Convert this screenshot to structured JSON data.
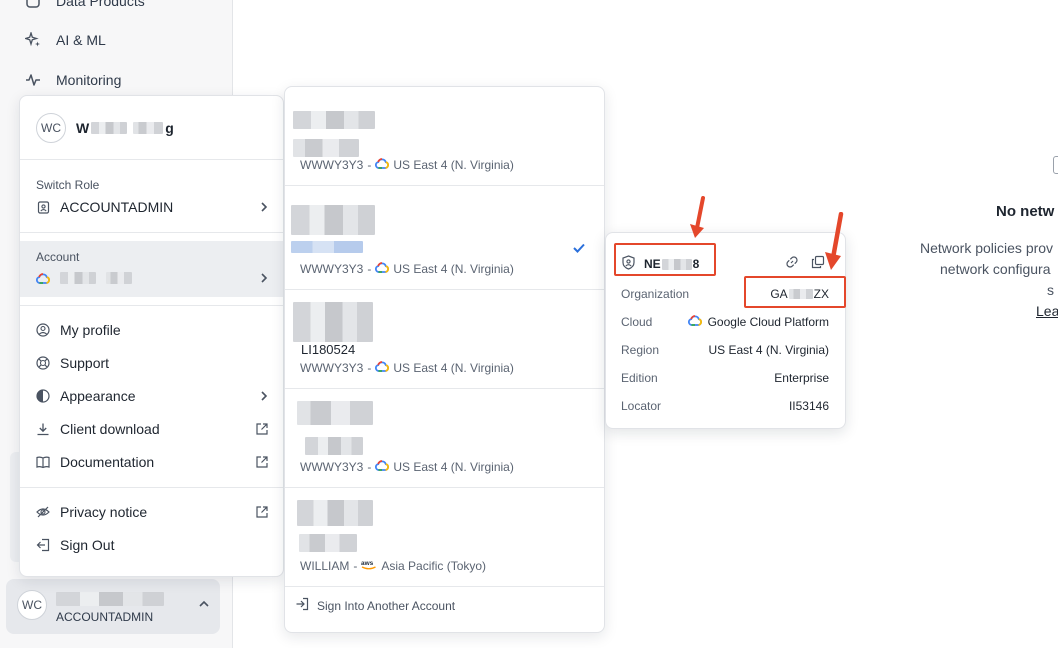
{
  "sidebar": {
    "items": [
      {
        "label": "Data Products",
        "icon": "data-products-icon"
      },
      {
        "label": "AI & ML",
        "icon": "sparkle-icon"
      },
      {
        "label": "Monitoring",
        "icon": "activity-icon"
      }
    ],
    "user_chip": {
      "initials": "WC",
      "role": "ACCOUNTADMIN"
    }
  },
  "user_menu": {
    "avatar_initials": "WC",
    "user_name_visible": "W",
    "user_name_tail": "g",
    "switch_role": {
      "label": "Switch Role",
      "value": "ACCOUNTADMIN"
    },
    "account": {
      "label": "Account"
    },
    "items": [
      {
        "label": "My profile",
        "icon": "user-circle-icon"
      },
      {
        "label": "Support",
        "icon": "lifebuoy-icon"
      },
      {
        "label": "Appearance",
        "icon": "contrast-icon"
      },
      {
        "label": "Client download",
        "icon": "download-icon"
      },
      {
        "label": "Documentation",
        "icon": "book-icon"
      }
    ],
    "footer_items": [
      {
        "label": "Privacy notice",
        "icon": "eye-off-icon"
      },
      {
        "label": "Sign Out",
        "icon": "sign-out-icon"
      }
    ]
  },
  "accounts": {
    "list": [
      {
        "org": "WWWY3Y3",
        "separator": "-",
        "region": "US East 4 (N. Virginia)",
        "cloud": "gcp",
        "selected": false,
        "fragment": ""
      },
      {
        "org": "WWWY3Y3",
        "separator": "-",
        "region": "US East 4 (N. Virginia)",
        "cloud": "gcp",
        "selected": true,
        "fragment": ""
      },
      {
        "org": "WWWY3Y3",
        "separator": "-",
        "region": "US East 4 (N. Virginia)",
        "cloud": "gcp",
        "selected": false,
        "fragment": "LI180524"
      },
      {
        "org": "WWWY3Y3",
        "separator": "-",
        "region": "US East 4 (N. Virginia)",
        "cloud": "gcp",
        "selected": false,
        "fragment": ""
      },
      {
        "org": "WILLIAM",
        "separator": "-",
        "region": "Asia Pacific (Tokyo)",
        "cloud": "aws",
        "selected": false,
        "fragment": ""
      }
    ],
    "sign_in_other": "Sign Into Another Account"
  },
  "account_details": {
    "name_prefix": "NE",
    "name_suffix": "8",
    "rows": [
      {
        "key": "Organization",
        "value_prefix": "GA",
        "value_suffix": "ZX"
      },
      {
        "key": "Cloud",
        "value": "Google Cloud Platform"
      },
      {
        "key": "Region",
        "value": "US East 4 (N. Virginia)"
      },
      {
        "key": "Edition",
        "value": "Enterprise"
      },
      {
        "key": "Locator",
        "value": "II53146"
      }
    ]
  },
  "main": {
    "empty_title": "No netw",
    "line1": "Network policies prov",
    "line2": "network configura",
    "line3": "s",
    "learn_more": "Lea"
  },
  "colors": {
    "accent": "#2a6fdb",
    "annotation_red": "#e4472b",
    "sidebar_bg": "#f7f7f8"
  }
}
